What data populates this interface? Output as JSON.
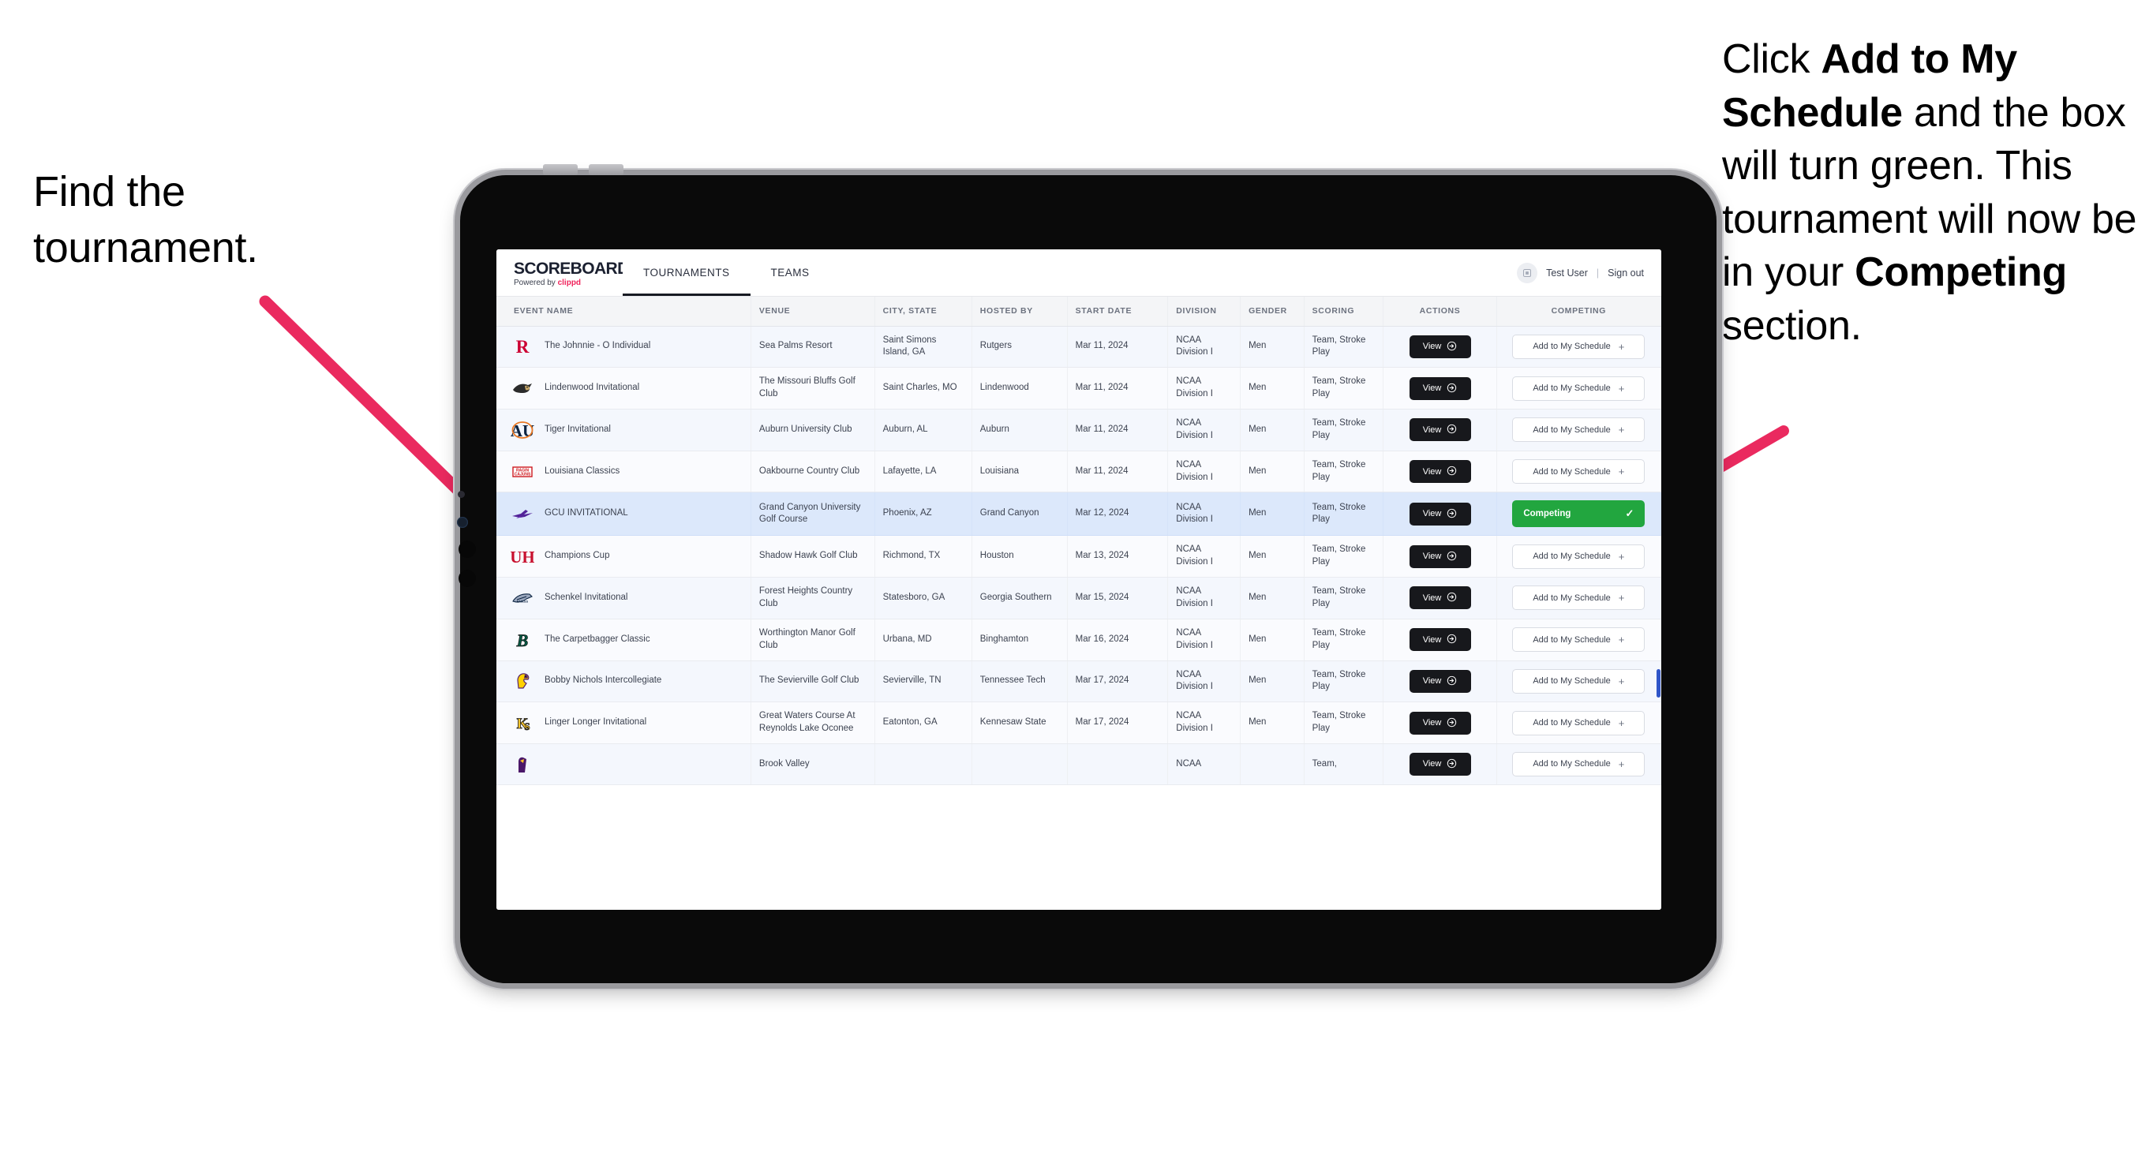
{
  "annotations": {
    "left": "Find the tournament.",
    "right_parts": [
      {
        "t": "Click ",
        "b": false
      },
      {
        "t": "Add to My Schedule",
        "b": true
      },
      {
        "t": " and the box will turn green. This tournament will now be in your ",
        "b": false
      },
      {
        "t": "Competing",
        "b": true
      },
      {
        "t": " section.",
        "b": false
      }
    ],
    "arrow_color": "#ea2a5f"
  },
  "app": {
    "brand": {
      "title": "SCOREBOARD",
      "powered_prefix": "Powered by ",
      "powered_brand": "clippd"
    },
    "nav": [
      {
        "label": "TOURNAMENTS",
        "active": true
      },
      {
        "label": "TEAMS",
        "active": false
      }
    ],
    "header_right": {
      "avatar_icon": "user-avatar-icon",
      "username": "Test User",
      "separator": "|",
      "signout": "Sign out"
    }
  },
  "table": {
    "columns": [
      "EVENT NAME",
      "VENUE",
      "CITY, STATE",
      "HOSTED BY",
      "START DATE",
      "DIVISION",
      "GENDER",
      "SCORING",
      "ACTIONS",
      "COMPETING"
    ],
    "labels": {
      "view": "View",
      "view_icon": "arrow-circle-right-icon",
      "add": "Add to My Schedule",
      "add_icon": "plus-icon",
      "competing": "Competing",
      "competing_icon": "check-icon"
    },
    "colors": {
      "competing_green": "#22a63f",
      "view_black": "#17181c",
      "selected_row": "#dce8fb"
    },
    "rows": [
      {
        "logo": "rutgers",
        "event": "The Johnnie - O Individual",
        "venue": "Sea Palms Resort",
        "city": "Saint Simons Island, GA",
        "host": "Rutgers",
        "date": "Mar 11, 2024",
        "division": "NCAA Division I",
        "gender": "Men",
        "scoring": "Team, Stroke Play",
        "competing": false,
        "selected": false
      },
      {
        "logo": "lindenwood",
        "event": "Lindenwood Invitational",
        "venue": "The Missouri Bluffs Golf Club",
        "city": "Saint Charles, MO",
        "host": "Lindenwood",
        "date": "Mar 11, 2024",
        "division": "NCAA Division I",
        "gender": "Men",
        "scoring": "Team, Stroke Play",
        "competing": false,
        "selected": false
      },
      {
        "logo": "auburn",
        "event": "Tiger Invitational",
        "venue": "Auburn University Club",
        "city": "Auburn, AL",
        "host": "Auburn",
        "date": "Mar 11, 2024",
        "division": "NCAA Division I",
        "gender": "Men",
        "scoring": "Team, Stroke Play",
        "competing": false,
        "selected": false
      },
      {
        "logo": "louisiana",
        "event": "Louisiana Classics",
        "venue": "Oakbourne Country Club",
        "city": "Lafayette, LA",
        "host": "Louisiana",
        "date": "Mar 11, 2024",
        "division": "NCAA Division I",
        "gender": "Men",
        "scoring": "Team, Stroke Play",
        "competing": false,
        "selected": false
      },
      {
        "logo": "gcu",
        "event": "GCU INVITATIONAL",
        "venue": "Grand Canyon University Golf Course",
        "city": "Phoenix, AZ",
        "host": "Grand Canyon",
        "date": "Mar 12, 2024",
        "division": "NCAA Division I",
        "gender": "Men",
        "scoring": "Team, Stroke Play",
        "competing": true,
        "selected": true
      },
      {
        "logo": "houston",
        "event": "Champions Cup",
        "venue": "Shadow Hawk Golf Club",
        "city": "Richmond, TX",
        "host": "Houston",
        "date": "Mar 13, 2024",
        "division": "NCAA Division I",
        "gender": "Men",
        "scoring": "Team, Stroke Play",
        "competing": false,
        "selected": false
      },
      {
        "logo": "georgiasouthern",
        "event": "Schenkel Invitational",
        "venue": "Forest Heights Country Club",
        "city": "Statesboro, GA",
        "host": "Georgia Southern",
        "date": "Mar 15, 2024",
        "division": "NCAA Division I",
        "gender": "Men",
        "scoring": "Team, Stroke Play",
        "competing": false,
        "selected": false
      },
      {
        "logo": "binghamton",
        "event": "The Carpetbagger Classic",
        "venue": "Worthington Manor Golf Club",
        "city": "Urbana, MD",
        "host": "Binghamton",
        "date": "Mar 16, 2024",
        "division": "NCAA Division I",
        "gender": "Men",
        "scoring": "Team, Stroke Play",
        "competing": false,
        "selected": false
      },
      {
        "logo": "tennesseetech",
        "event": "Bobby Nichols Intercollegiate",
        "venue": "The Sevierville Golf Club",
        "city": "Sevierville, TN",
        "host": "Tennessee Tech",
        "date": "Mar 17, 2024",
        "division": "NCAA Division I",
        "gender": "Men",
        "scoring": "Team, Stroke Play",
        "competing": false,
        "selected": false
      },
      {
        "logo": "kennesaw",
        "event": "Linger Longer Invitational",
        "venue": "Great Waters Course At Reynolds Lake Oconee",
        "city": "Eatonton, GA",
        "host": "Kennesaw State",
        "date": "Mar 17, 2024",
        "division": "NCAA Division I",
        "gender": "Men",
        "scoring": "Team, Stroke Play",
        "competing": false,
        "selected": false
      },
      {
        "logo": "eastcarolina",
        "event": "",
        "venue": "Brook Valley",
        "city": "",
        "host": "",
        "date": "",
        "division": "NCAA",
        "gender": "",
        "scoring": "Team,",
        "competing": false,
        "selected": false
      }
    ]
  }
}
